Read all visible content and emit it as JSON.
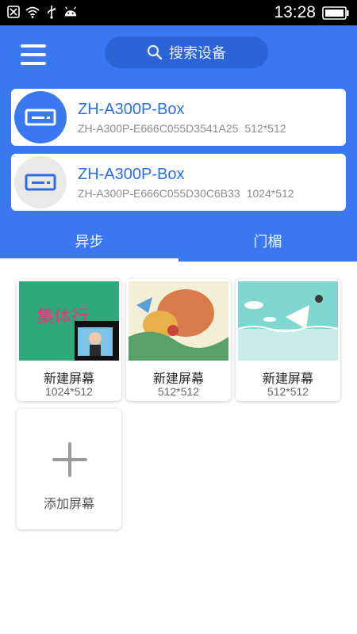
{
  "status_bar": {
    "time": "13:28",
    "icons": [
      "sim-off-icon",
      "wifi-icon",
      "usb-icon",
      "android-icon",
      "battery-icon"
    ]
  },
  "header": {
    "search_placeholder": "搜索设备"
  },
  "devices": [
    {
      "name": "ZH-A300P-Box",
      "id": "ZH-A300P-E666C055D3541A25",
      "resolution": "512*512",
      "status_color": "#3a78f2"
    },
    {
      "name": "ZH-A300P-Box",
      "id": "ZH-A300P-E666C055D30C6B33",
      "resolution": "1024*512",
      "status_color": "#e6e6e6"
    }
  ],
  "tabs": [
    {
      "label": "异步",
      "active": true
    },
    {
      "label": "门楣",
      "active": false
    }
  ],
  "screens": [
    {
      "title": "新建屏幕",
      "resolution": "1024*512",
      "thumb_text": "集体行"
    },
    {
      "title": "新建屏幕",
      "resolution": "512*512"
    },
    {
      "title": "新建屏幕",
      "resolution": "512*512"
    }
  ],
  "add_screen": {
    "label": "添加屏幕"
  },
  "colors": {
    "accent": "#3a78f2",
    "search_bg": "#2c63d6"
  }
}
